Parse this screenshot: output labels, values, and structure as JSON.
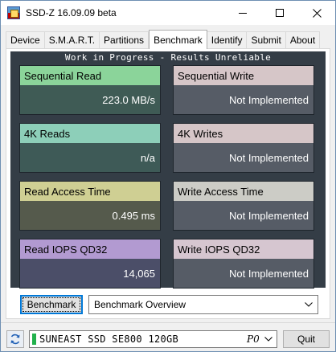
{
  "window": {
    "title": "SSD-Z 16.09.09 beta",
    "controls": {
      "minimize": "–",
      "maximize": "☐",
      "close": "✕"
    }
  },
  "tabs": [
    {
      "label": "Device",
      "active": false
    },
    {
      "label": "S.M.A.R.T.",
      "active": false
    },
    {
      "label": "Partitions",
      "active": false
    },
    {
      "label": "Benchmark",
      "active": true
    },
    {
      "label": "Identify",
      "active": false
    },
    {
      "label": "Submit",
      "active": false
    },
    {
      "label": "About",
      "active": false
    }
  ],
  "benchmark": {
    "banner": "Work in Progress - Results Unreliable",
    "cards": [
      {
        "title": "Sequential Read",
        "value": "223.0 MB/s"
      },
      {
        "title": "Sequential Write",
        "value": "Not Implemented"
      },
      {
        "title": "4K Reads",
        "value": "n/a"
      },
      {
        "title": "4K Writes",
        "value": "Not Implemented"
      },
      {
        "title": "Read Access Time",
        "value": "0.495 ms"
      },
      {
        "title": "Write Access Time",
        "value": "Not Implemented"
      },
      {
        "title": "Read IOPS QD32",
        "value": "14,065"
      },
      {
        "title": "Write IOPS QD32",
        "value": "Not Implemented"
      }
    ],
    "button_label": "Benchmark",
    "mode_select": {
      "selected": "Benchmark Overview"
    }
  },
  "status_bar": {
    "drive_name": "SUNEAST SSD SE800 120GB",
    "drive_port": "P0",
    "quit_label": "Quit"
  },
  "colors": {
    "panel_background": "#343d46",
    "active_drive_led": "#22b14c",
    "focus_border": "#0078d7"
  },
  "icons": {
    "app": "ssd-z-app-icon",
    "refresh": "refresh-icon",
    "dropdown": "chevron-down-icon"
  }
}
